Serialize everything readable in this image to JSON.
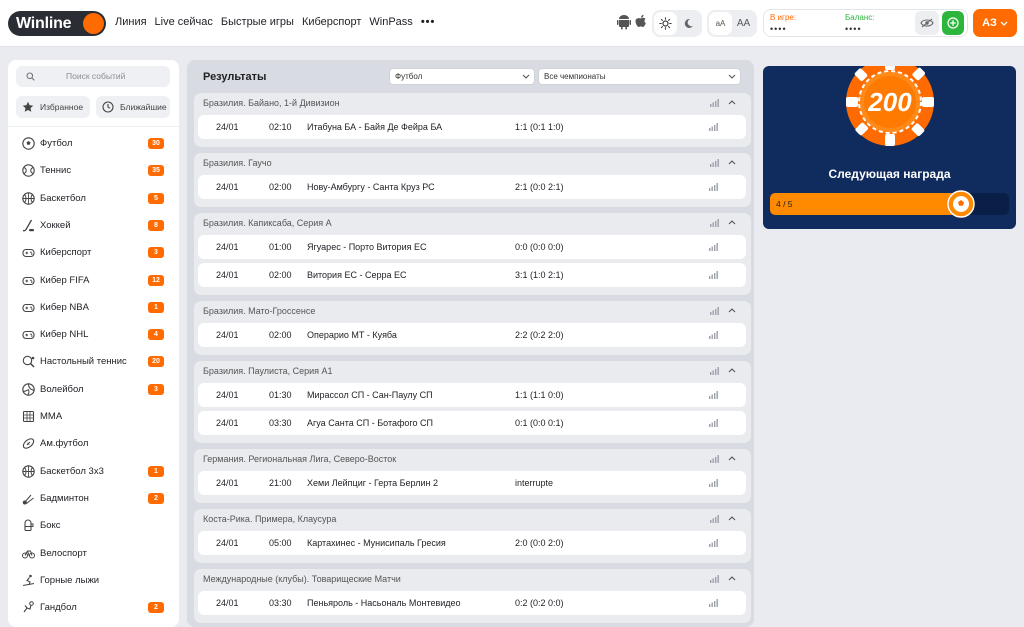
{
  "brand": {
    "logo_text": "Winline",
    "accent": "#ff6b00",
    "green": "#2eb53e",
    "promo_bg": "#102c5e"
  },
  "nav": [
    "Линия",
    "Live сейчас",
    "Быстрые игры",
    "Киберспорт",
    "WinPass",
    "•••"
  ],
  "header": {
    "icons": [
      "android-icon",
      "apple-icon",
      "sun-icon",
      "moon-icon"
    ],
    "font_small": "аА",
    "font_large": "АА",
    "in_game_label": "В игре:",
    "in_game_value": "••••",
    "balance_label": "Баланс:",
    "balance_value": "••••",
    "account_label": "АЗ"
  },
  "sidebar": {
    "search_placeholder": "Поиск событий",
    "favorites_label": "Избранное",
    "nearest_label": "Ближайшие",
    "sports": [
      {
        "name": "Футбол",
        "count": "30",
        "icon": "soccer-icon"
      },
      {
        "name": "Теннис",
        "count": "35",
        "icon": "tennis-icon"
      },
      {
        "name": "Баскетбол",
        "count": "5",
        "icon": "basketball-icon"
      },
      {
        "name": "Хоккей",
        "count": "8",
        "icon": "hockey-icon"
      },
      {
        "name": "Киберспорт",
        "count": "3",
        "icon": "gamepad-icon"
      },
      {
        "name": "Кибер FIFA",
        "count": "12",
        "icon": "gamepad-icon"
      },
      {
        "name": "Кибер NBA",
        "count": "1",
        "icon": "gamepad-icon"
      },
      {
        "name": "Кибер NHL",
        "count": "4",
        "icon": "gamepad-icon"
      },
      {
        "name": "Настольный теннис",
        "count": "20",
        "icon": "table-tennis-icon"
      },
      {
        "name": "Волейбол",
        "count": "3",
        "icon": "volleyball-icon"
      },
      {
        "name": "MMA",
        "count": "",
        "icon": "mma-icon"
      },
      {
        "name": "Ам.футбол",
        "count": "",
        "icon": "american-football-icon"
      },
      {
        "name": "Баскетбол 3x3",
        "count": "1",
        "icon": "basketball-icon"
      },
      {
        "name": "Бадминтон",
        "count": "2",
        "icon": "badminton-icon"
      },
      {
        "name": "Бокс",
        "count": "",
        "icon": "boxing-icon"
      },
      {
        "name": "Велоспорт",
        "count": "",
        "icon": "bicycle-icon"
      },
      {
        "name": "Горные лыжи",
        "count": "",
        "icon": "ski-icon"
      },
      {
        "name": "Гандбол",
        "count": "2",
        "icon": "handball-icon"
      }
    ]
  },
  "results": {
    "title": "Результаты",
    "sport_filter": "Футбол",
    "league_filter": "Все чемпионаты",
    "leagues": [
      {
        "name": "Бразилия. Байано, 1-й Дивизион",
        "matches": [
          {
            "date": "24/01",
            "time": "02:10",
            "teams": "Итабуна БА - Байя Де Фейра БА",
            "score": "1:1 (0:1 1:0)"
          }
        ]
      },
      {
        "name": "Бразилия. Гаучо",
        "matches": [
          {
            "date": "24/01",
            "time": "02:00",
            "teams": "Нову-Амбургу - Санта Круз РС",
            "score": "2:1 (0:0 2:1)"
          }
        ]
      },
      {
        "name": "Бразилия. Капиксаба, Серия А",
        "matches": [
          {
            "date": "24/01",
            "time": "01:00",
            "teams": "Ягуарес - Порто Витория ЕС",
            "score": "0:0 (0:0 0:0)"
          },
          {
            "date": "24/01",
            "time": "02:00",
            "teams": "Витория ЕС - Серра ЕС",
            "score": "3:1 (1:0 2:1)"
          }
        ]
      },
      {
        "name": "Бразилия. Мато-Гроссенсе",
        "matches": [
          {
            "date": "24/01",
            "time": "02:00",
            "teams": "Операрио МТ - Куяба",
            "score": "2:2 (0:2 2:0)"
          }
        ]
      },
      {
        "name": "Бразилия. Паулиста, Серия А1",
        "matches": [
          {
            "date": "24/01",
            "time": "01:30",
            "teams": "Мирассол СП - Сан-Паулу СП",
            "score": "1:1 (1:1 0:0)"
          },
          {
            "date": "24/01",
            "time": "03:30",
            "teams": "Агуа Санта СП - Ботафого СП",
            "score": "0:1 (0:0 0:1)"
          }
        ]
      },
      {
        "name": "Германия. Региональная Лига, Северо-Восток",
        "matches": [
          {
            "date": "24/01",
            "time": "21:00",
            "teams": "Хеми Лейпциг - Герта Берлин 2",
            "score": "interrupte"
          }
        ]
      },
      {
        "name": "Коста-Рика. Примера, Клаусура",
        "matches": [
          {
            "date": "24/01",
            "time": "05:00",
            "teams": "Картахинес - Мунисипаль Гресия",
            "score": "2:0 (0:0 2:0)"
          }
        ]
      },
      {
        "name": "Международные (клубы). Товарищеские Матчи",
        "matches": [
          {
            "date": "24/01",
            "time": "03:30",
            "teams": "Пеньяроль - Насьональ Монтевидео",
            "score": "0:2 (0:2 0:0)"
          }
        ]
      }
    ]
  },
  "promo": {
    "chip_value": "200",
    "label": "Следующая награда",
    "progress_text": "4 / 5",
    "progress": 0.8
  }
}
